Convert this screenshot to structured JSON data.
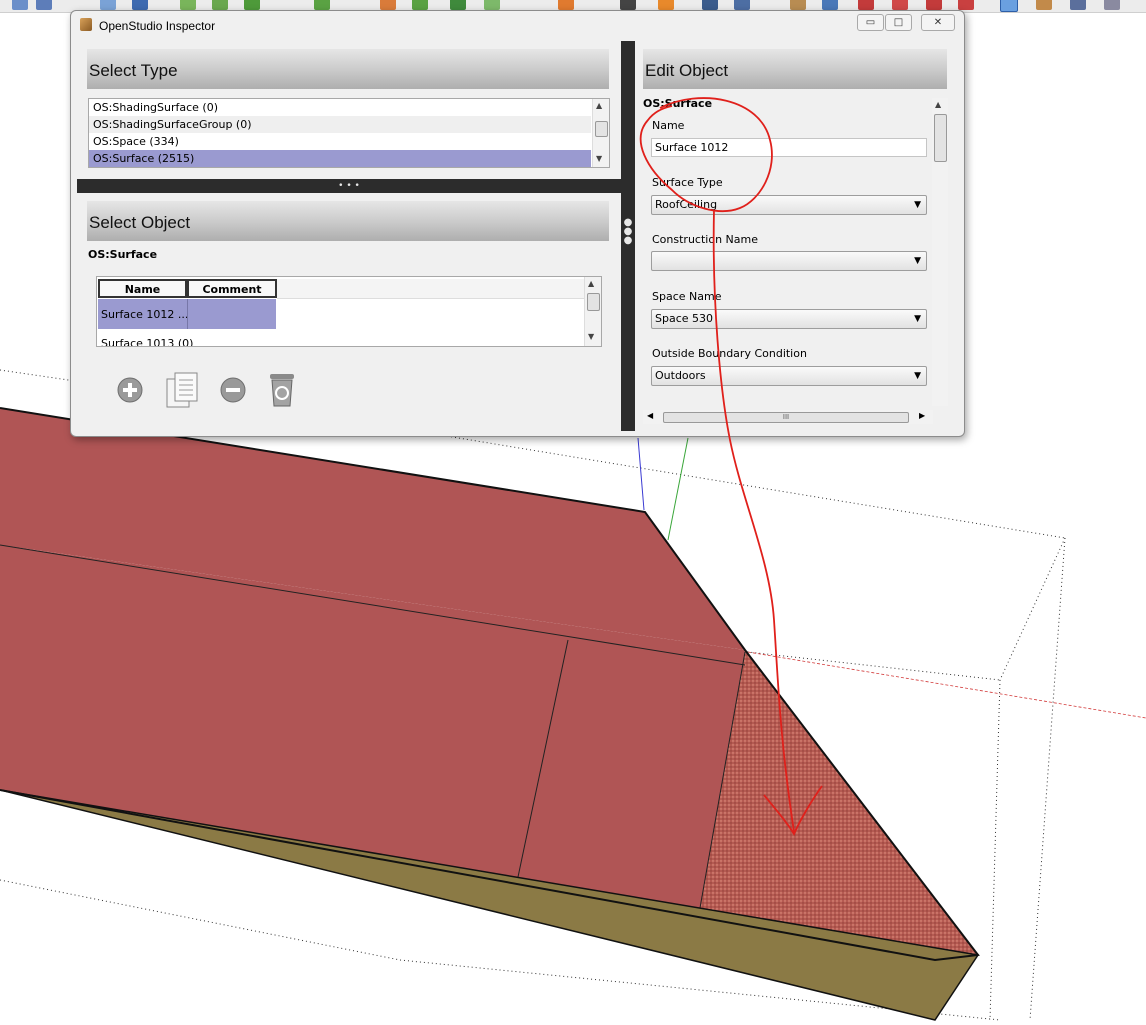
{
  "window": {
    "title": "OpenStudio Inspector",
    "buttons": {
      "minimize": "▭",
      "maximize": "□",
      "close": "✕"
    }
  },
  "select_type": {
    "header": "Select Type",
    "items": [
      {
        "label": "OS:ShadingSurface (0)",
        "selected": false
      },
      {
        "label": "OS:ShadingSurfaceGroup (0)",
        "selected": false
      },
      {
        "label": "OS:Space (334)",
        "selected": false
      },
      {
        "label": "OS:Surface (2515)",
        "selected": true
      }
    ]
  },
  "splitter_dots": "• • •",
  "select_object": {
    "header": "Select Object",
    "type_label": "OS:Surface",
    "columns": [
      "Name",
      "Comment"
    ],
    "rows": [
      {
        "name": "Surface 1012 ...",
        "comment": ""
      },
      {
        "name": "Surface 1013 (0)",
        "comment": ""
      }
    ]
  },
  "edit_object": {
    "header": "Edit Object",
    "type_label": "OS:Surface",
    "fields": {
      "name_label": "Name",
      "name_value": "Surface 1012",
      "surface_type_label": "Surface Type",
      "surface_type_value": "RoofCeiling",
      "construction_label": "Construction Name",
      "construction_value": "",
      "space_label": "Space Name",
      "space_value": "Space 530",
      "outside_bc_label": "Outside Boundary Condition",
      "outside_bc_value": "Outdoors"
    },
    "hscroll_grip": "III"
  },
  "colors": {
    "roof": "#b05555",
    "slab_side": "#8b7a45",
    "annotation": "#e0201b",
    "selection": "#9a9ad0"
  }
}
